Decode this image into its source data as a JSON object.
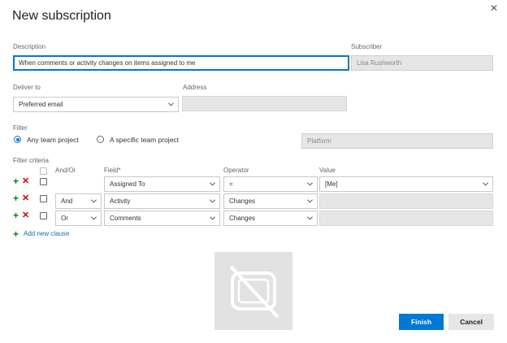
{
  "dialog": {
    "title": "New subscription",
    "close_icon": "close-icon"
  },
  "description": {
    "label": "Description",
    "value": "When comments or activity changes on items assigned to me"
  },
  "subscriber": {
    "label": "Subscriber",
    "value": "Lisa Rushworth"
  },
  "deliver_to": {
    "label": "Deliver to",
    "selected": "Preferred email"
  },
  "address": {
    "label": "Address",
    "value": ""
  },
  "filter": {
    "label": "Filter",
    "any_project": "Any team project",
    "specific_project": "A specific team project",
    "project_value": "Platform",
    "selected": "any"
  },
  "criteria": {
    "label": "Filter criteria",
    "columns": {
      "andor": "And/Or",
      "field": "Field*",
      "operator": "Operator",
      "value": "Value"
    },
    "rows": [
      {
        "andor": "",
        "field": "Assigned To",
        "operator": "=",
        "value": "[Me]"
      },
      {
        "andor": "And",
        "field": "Activity",
        "operator": "Changes",
        "value": ""
      },
      {
        "andor": "Or",
        "field": "Comments",
        "operator": "Changes",
        "value": ""
      }
    ],
    "add_clause": "Add new clause"
  },
  "footer": {
    "finish": "Finish",
    "cancel": "Cancel"
  },
  "colors": {
    "accent": "#0078d4",
    "add_green": "#107c10",
    "remove_red": "#d00000"
  }
}
